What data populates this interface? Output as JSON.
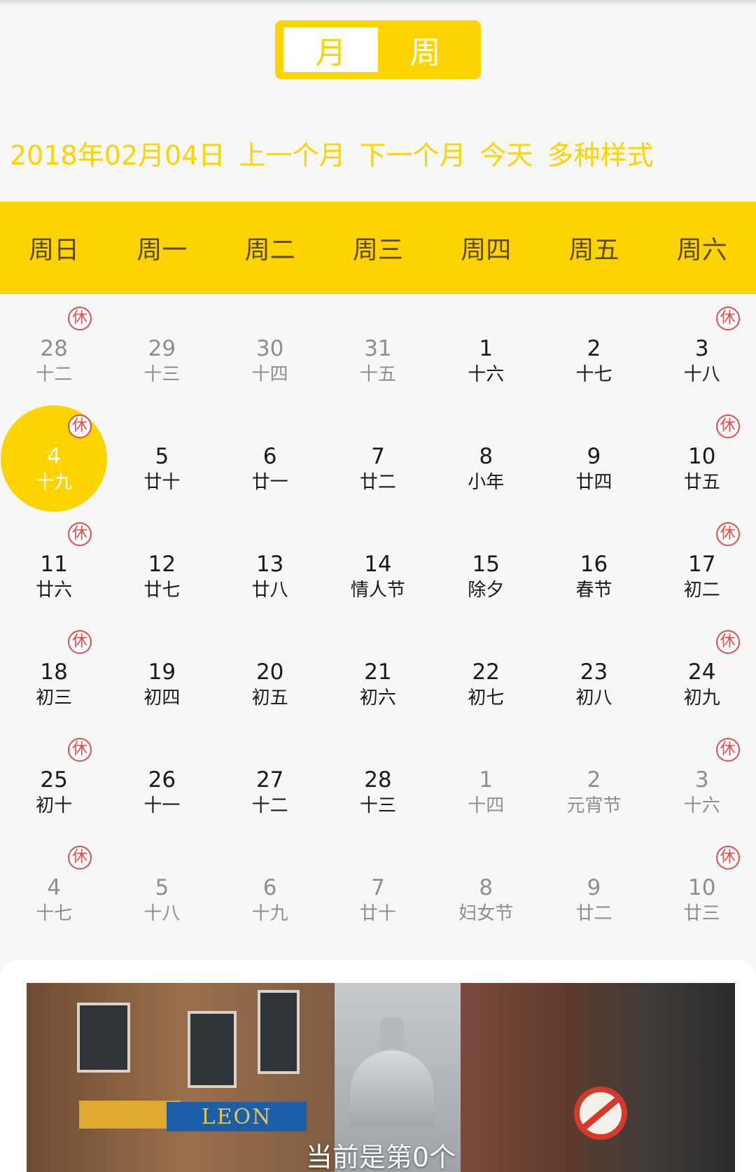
{
  "toggle": {
    "month": "月",
    "week": "周",
    "selected": "month"
  },
  "nav": {
    "current_date": "2018年02月04日",
    "prev_month": "上一个月",
    "next_month": "下一个月",
    "today": "今天",
    "styles": "多种样式"
  },
  "weekdays": [
    "周日",
    "周一",
    "周二",
    "周三",
    "周四",
    "周五",
    "周六"
  ],
  "rest_mark": "休",
  "weeks": [
    [
      {
        "day": "28",
        "lunar": "十二",
        "other": true,
        "rest": true
      },
      {
        "day": "29",
        "lunar": "十三",
        "other": true,
        "rest": false
      },
      {
        "day": "30",
        "lunar": "十四",
        "other": true,
        "rest": false
      },
      {
        "day": "31",
        "lunar": "十五",
        "other": true,
        "rest": false
      },
      {
        "day": "1",
        "lunar": "十六",
        "other": false,
        "rest": false
      },
      {
        "day": "2",
        "lunar": "十七",
        "other": false,
        "rest": false
      },
      {
        "day": "3",
        "lunar": "十八",
        "other": false,
        "rest": true
      }
    ],
    [
      {
        "day": "4",
        "lunar": "十九",
        "other": false,
        "rest": true,
        "selected": true
      },
      {
        "day": "5",
        "lunar": "廿十",
        "other": false,
        "rest": false
      },
      {
        "day": "6",
        "lunar": "廿一",
        "other": false,
        "rest": false
      },
      {
        "day": "7",
        "lunar": "廿二",
        "other": false,
        "rest": false
      },
      {
        "day": "8",
        "lunar": "小年",
        "other": false,
        "rest": false
      },
      {
        "day": "9",
        "lunar": "廿四",
        "other": false,
        "rest": false
      },
      {
        "day": "10",
        "lunar": "廿五",
        "other": false,
        "rest": true
      }
    ],
    [
      {
        "day": "11",
        "lunar": "廿六",
        "other": false,
        "rest": true
      },
      {
        "day": "12",
        "lunar": "廿七",
        "other": false,
        "rest": false
      },
      {
        "day": "13",
        "lunar": "廿八",
        "other": false,
        "rest": false
      },
      {
        "day": "14",
        "lunar": "情人节",
        "other": false,
        "rest": false
      },
      {
        "day": "15",
        "lunar": "除夕",
        "other": false,
        "rest": false
      },
      {
        "day": "16",
        "lunar": "春节",
        "other": false,
        "rest": false
      },
      {
        "day": "17",
        "lunar": "初二",
        "other": false,
        "rest": true
      }
    ],
    [
      {
        "day": "18",
        "lunar": "初三",
        "other": false,
        "rest": true
      },
      {
        "day": "19",
        "lunar": "初四",
        "other": false,
        "rest": false
      },
      {
        "day": "20",
        "lunar": "初五",
        "other": false,
        "rest": false
      },
      {
        "day": "21",
        "lunar": "初六",
        "other": false,
        "rest": false
      },
      {
        "day": "22",
        "lunar": "初七",
        "other": false,
        "rest": false
      },
      {
        "day": "23",
        "lunar": "初八",
        "other": false,
        "rest": false
      },
      {
        "day": "24",
        "lunar": "初九",
        "other": false,
        "rest": true
      }
    ],
    [
      {
        "day": "25",
        "lunar": "初十",
        "other": false,
        "rest": true
      },
      {
        "day": "26",
        "lunar": "十一",
        "other": false,
        "rest": false
      },
      {
        "day": "27",
        "lunar": "十二",
        "other": false,
        "rest": false
      },
      {
        "day": "28",
        "lunar": "十三",
        "other": false,
        "rest": false
      },
      {
        "day": "1",
        "lunar": "十四",
        "other": true,
        "rest": false
      },
      {
        "day": "2",
        "lunar": "元宵节",
        "other": true,
        "rest": false
      },
      {
        "day": "3",
        "lunar": "十六",
        "other": true,
        "rest": true
      }
    ],
    [
      {
        "day": "4",
        "lunar": "十七",
        "other": true,
        "rest": true
      },
      {
        "day": "5",
        "lunar": "十八",
        "other": true,
        "rest": false
      },
      {
        "day": "6",
        "lunar": "十九",
        "other": true,
        "rest": false
      },
      {
        "day": "7",
        "lunar": "廿十",
        "other": true,
        "rest": false
      },
      {
        "day": "8",
        "lunar": "妇女节",
        "other": true,
        "rest": false
      },
      {
        "day": "9",
        "lunar": "廿二",
        "other": true,
        "rest": false
      },
      {
        "day": "10",
        "lunar": "廿三",
        "other": true,
        "rest": true
      }
    ]
  ],
  "banner": {
    "caption": "当前是第0个",
    "shop_sign": "LEON"
  },
  "colors": {
    "accent": "#fdd400",
    "rest": "#e34d4d",
    "text": "#1a1a1a",
    "muted": "#8e8e8e"
  }
}
